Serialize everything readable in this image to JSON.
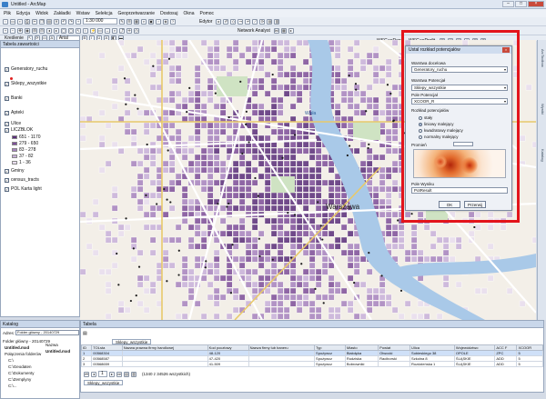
{
  "window": {
    "title": "Untitled - ArcMap"
  },
  "menu": [
    "Plik",
    "Edycja",
    "Widok",
    "Zakładki",
    "Wstaw",
    "Selekcja",
    "Geoprzetwarzanie",
    "Dostosuj",
    "Okna",
    "Pomoc"
  ],
  "toolbar": {
    "scale_value": "1:30 000",
    "editor_label": "Edytor",
    "drawing_label": "Kreślenie",
    "font_value": "Arial",
    "network_label": "Network Analyst",
    "wsgeo_report": "WSGeoRepo",
    "wsgeo_profit": "WSGeoProfit"
  },
  "toc": {
    "title": "Tabela zawartości",
    "items": [
      {
        "label": "Generatory_ruchu",
        "checked": true
      },
      {
        "label": "Sklepy_wszystkie",
        "checked": true
      },
      {
        "label": "Banki",
        "checked": true
      },
      {
        "label": "Apteki",
        "checked": true
      },
      {
        "label": "Ulice",
        "checked": true
      },
      {
        "label": "LICZBLOK",
        "checked": true
      },
      {
        "label": "Gminy",
        "checked": true
      },
      {
        "label": "census_tracts",
        "checked": true
      },
      {
        "label": "POL Karta light",
        "checked": true
      }
    ],
    "legend": [
      {
        "label": "651 - 1170",
        "color": "#5a2e7a"
      },
      {
        "label": "279 - 650",
        "color": "#7e4f9a"
      },
      {
        "label": "83 - 278",
        "color": "#a783bf"
      },
      {
        "label": "37 - 82",
        "color": "#c8b1da"
      },
      {
        "label": "1 - 36",
        "color": "#e9def0"
      }
    ]
  },
  "catalog": {
    "title": "Katalog",
    "address_label": "Adres:",
    "address_value": "Folder główny - 20140729",
    "folder_root": "Folder główny - 20140729",
    "items": [
      "Untitled.mxd",
      "Połączenia folderów",
      "C:\\",
      "C:\\Geodaten",
      "C:\\Dokumenty",
      "C:\\Zemplyny",
      "C:\\..."
    ]
  },
  "table_panel": {
    "title": "Tabela",
    "tab": "Sklepy_wszystkie",
    "name_label": "Nazwa",
    "name_value": "Untitled.mxd",
    "columns": [
      "ID",
      "TOLsta",
      "Nazwa prawna firmy handlowej",
      "Kod pocztowy",
      "Nazwa firmy lub baneru",
      "Typ",
      "Miasto",
      "Powiat",
      "Ulica",
      "Województwo",
      "ACC F",
      "XCOOR"
    ],
    "rows": [
      [
        "1",
        "00568304",
        "",
        "48-120",
        "",
        "Spożywcz",
        "Białołęka",
        "Otwocki",
        "Sobieskiego 38",
        "OPOLE",
        "ZPC",
        "5"
      ],
      [
        "2",
        "00568587",
        "",
        "47-420",
        "",
        "Spożywcz",
        "Rudziska",
        "Raciborski",
        "Szkolna 8",
        "ŚLĄSKIE",
        "ADD",
        "5"
      ],
      [
        "3",
        "00568659",
        "",
        "41-509",
        "",
        "Spożywcz",
        "Bobrowniki",
        "",
        "Rozdzieńska 1",
        "ŚLĄSKIE",
        "ADD",
        "5"
      ]
    ],
    "record_info": "(1340 z 34526 wszystkich)",
    "bottom_tab": "Sklepy_wszystkie"
  },
  "map": {
    "city_label": "Warszawa",
    "river_label": "Wisła"
  },
  "dialog": {
    "title": "Ustal rozkład potencjałów",
    "target_layer_label": "Warstwa docelowa",
    "target_layer_value": "Generatory_ruchu",
    "potential_layer_label": "Warstwa Potencjał",
    "potential_layer_value": "Sklepy_wszystkie",
    "potential_field_label": "Pole Potencjał",
    "potential_field_value": "XCOOR_R",
    "distribution_label": "Rozkład potencjałów",
    "options": [
      {
        "label": "stały",
        "selected": false
      },
      {
        "label": "liniowy malejący",
        "selected": true
      },
      {
        "label": "kwadratowy malejący",
        "selected": false
      },
      {
        "label": "normalny malejący",
        "selected": false
      }
    ],
    "radius_label": "Promień",
    "result_field_label": "Pole Wyniku",
    "result_field_value": "PotResult",
    "ok_label": "OK",
    "cancel_label": "Przerwij"
  },
  "right_bar": [
    "ArcToolbox",
    "Wyniki",
    "Katalog"
  ],
  "colors": {
    "accent_red": "#e3141b",
    "purple_dark": "#5a2e7a",
    "river": "#a9c9e8"
  }
}
